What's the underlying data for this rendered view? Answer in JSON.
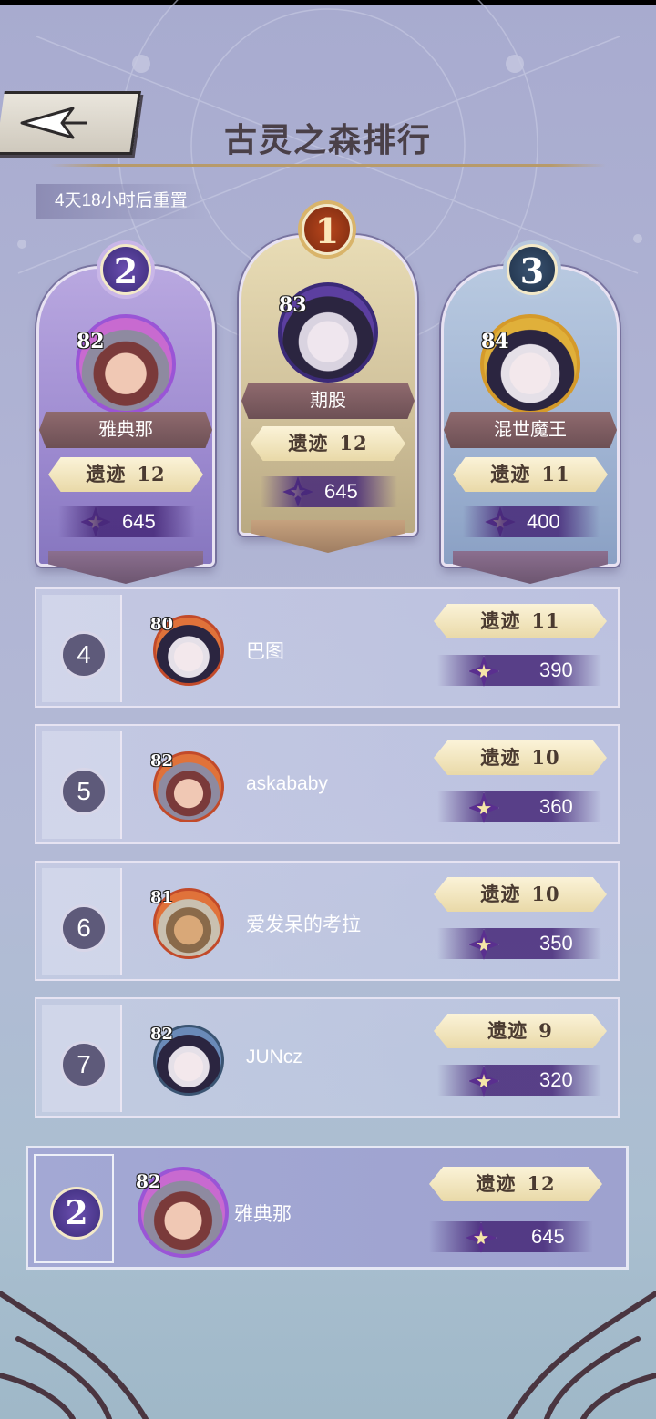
{
  "header": {
    "title": "古灵之森排行",
    "reset_timer": "4天18小时后重置",
    "back_icon": "back-arrow-icon"
  },
  "relic_label": "遗迹",
  "podium": [
    {
      "rank": "1",
      "level": "83",
      "name": "期股",
      "relics": "12",
      "score": "645"
    },
    {
      "rank": "2",
      "level": "82",
      "name": "雅典那",
      "relics": "12",
      "score": "645"
    },
    {
      "rank": "3",
      "level": "84",
      "name": "混世魔王",
      "relics": "11",
      "score": "400"
    }
  ],
  "list": [
    {
      "rank": "4",
      "level": "80",
      "name": "巴图",
      "relics": "11",
      "score": "390"
    },
    {
      "rank": "5",
      "level": "82",
      "name": "askababy",
      "relics": "10",
      "score": "360"
    },
    {
      "rank": "6",
      "level": "81",
      "name": "爱发呆的考拉",
      "relics": "10",
      "score": "350"
    },
    {
      "rank": "7",
      "level": "82",
      "name": "JUNcz",
      "relics": "9",
      "score": "320"
    }
  ],
  "self": {
    "rank": "2",
    "level": "82",
    "name": "雅典那",
    "relics": "12",
    "score": "645"
  },
  "colors": {
    "gold": "#d9b46a",
    "purple": "#5a2f8f",
    "background": "#b0b4d4"
  }
}
